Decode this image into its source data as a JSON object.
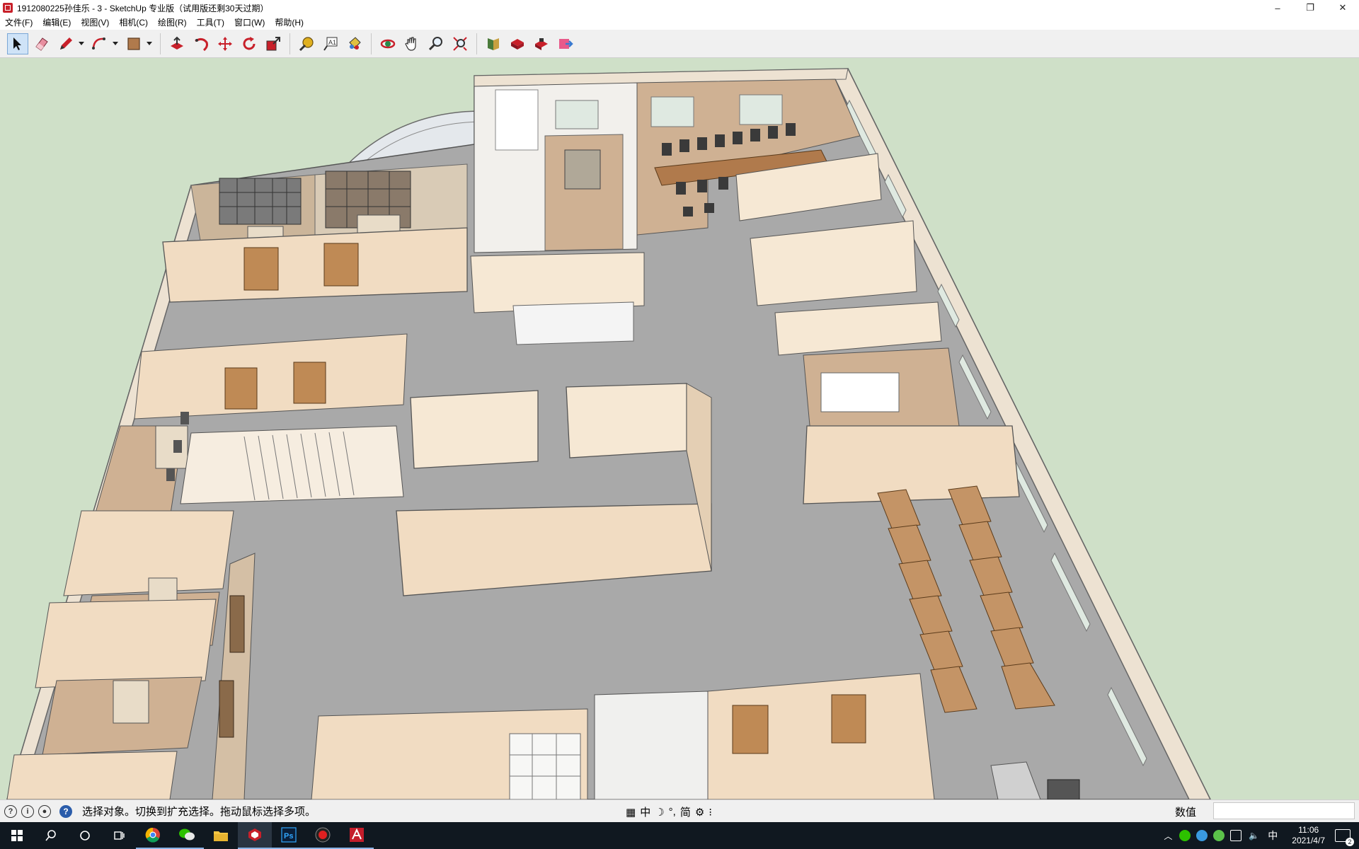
{
  "window": {
    "title": "1912080225孙佳乐 - 3 - SketchUp 专业版（试用版还剩30天过期）",
    "minimize": "–",
    "restore": "❐",
    "close": "✕"
  },
  "menu": [
    {
      "label": "文件(F)"
    },
    {
      "label": "编辑(E)"
    },
    {
      "label": "视图(V)"
    },
    {
      "label": "相机(C)"
    },
    {
      "label": "绘图(R)"
    },
    {
      "label": "工具(T)"
    },
    {
      "label": "窗口(W)"
    },
    {
      "label": "帮助(H)"
    }
  ],
  "toolbar": {
    "groups": [
      [
        "select",
        "eraser",
        "pencil",
        "arc",
        "rectangle"
      ],
      [
        "push-pull",
        "follow-me",
        "move",
        "rotate",
        "scale"
      ],
      [
        "tape-measure",
        "text",
        "paint-bucket"
      ],
      [
        "orbit",
        "pan",
        "zoom",
        "zoom-extents"
      ],
      [
        "components",
        "warehouse",
        "extension-warehouse",
        "send-to-layout"
      ]
    ],
    "active_tool": "select"
  },
  "status": {
    "message": "选择对象。切换到扩充选择。拖动鼠标选择多项。",
    "ime": [
      "中",
      "☽",
      "°,",
      "简",
      "⚙",
      "⁝"
    ],
    "measurements_label": "数值",
    "measurements_value": ""
  },
  "taskbar": {
    "apps": [
      "start",
      "search",
      "cortana",
      "task-view",
      "chrome",
      "wechat",
      "file-explorer",
      "sketchup",
      "photoshop",
      "recorder",
      "autocad"
    ],
    "active_app": "sketchup",
    "tray_lang": "中",
    "time": "11:06",
    "date": "2021/4/7",
    "notifications": "2"
  },
  "colors": {
    "sky": "#cfe0c8",
    "floor": "#a9a9a9",
    "wall_top": "#f6e8d4",
    "wall_face": "#f1dcc2",
    "wood": "#c49466",
    "door": "#bf8a55",
    "taskbar": "#101820",
    "accent": "#7aa7d6"
  }
}
